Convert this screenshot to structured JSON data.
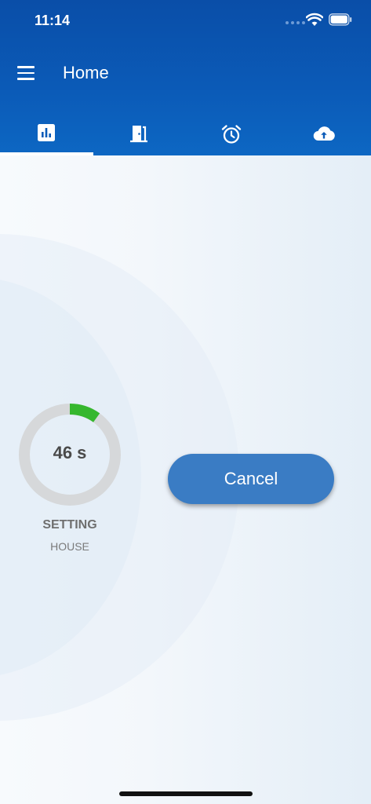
{
  "status_bar": {
    "time": "11:14"
  },
  "app_bar": {
    "title": "Home",
    "menu_icon": "hamburger-menu-icon"
  },
  "tabs": [
    {
      "icon": "bar-chart-icon",
      "selected": true
    },
    {
      "icon": "door-icon",
      "selected": false
    },
    {
      "icon": "alarm-clock-icon",
      "selected": false
    },
    {
      "icon": "cloud-upload-icon",
      "selected": false
    }
  ],
  "timer": {
    "value_text": "46 s",
    "progress_fraction": 0.1,
    "label": "SETTING",
    "sublabel": "HOUSE",
    "progress_color": "#36b72e",
    "track_color": "#d6d8da"
  },
  "actions": {
    "cancel_label": "Cancel"
  },
  "colors": {
    "header": "#0b5bb8",
    "button": "#3a7cc4"
  }
}
